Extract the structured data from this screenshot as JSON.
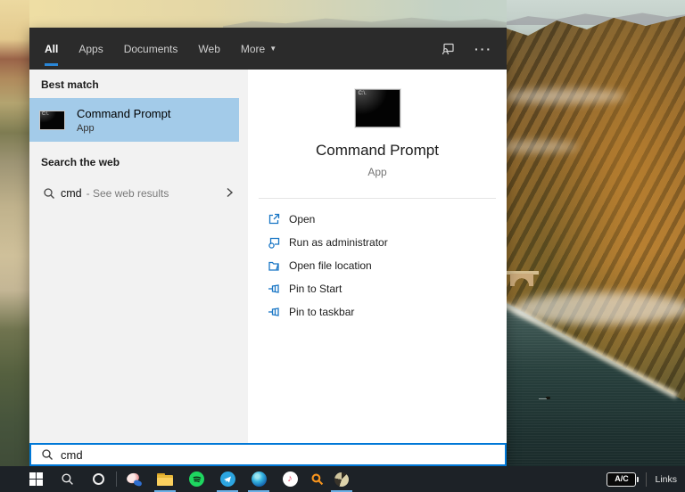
{
  "header": {
    "tabs": [
      {
        "label": "All",
        "active": true
      },
      {
        "label": "Apps",
        "active": false
      },
      {
        "label": "Documents",
        "active": false
      },
      {
        "label": "Web",
        "active": false
      },
      {
        "label": "More",
        "active": false,
        "has_dropdown": true
      }
    ],
    "icons": [
      "feedback-icon",
      "ellipsis-icon"
    ]
  },
  "left_panel": {
    "best_match_label": "Best match",
    "best_match": {
      "title": "Command Prompt",
      "subtitle": "App",
      "icon": "cmd-terminal-icon"
    },
    "search_web_label": "Search the web",
    "web_result": {
      "query": "cmd",
      "hint": "- See web results",
      "icon": "search-icon",
      "chevron": "chevron-right-icon"
    }
  },
  "right_panel": {
    "title": "Command Prompt",
    "subtitle": "App",
    "icon": "cmd-terminal-icon-large",
    "actions": [
      {
        "icon": "open-icon",
        "label": "Open"
      },
      {
        "icon": "run-as-admin-icon",
        "label": "Run as administrator"
      },
      {
        "icon": "file-location-icon",
        "label": "Open file location"
      },
      {
        "icon": "pin-to-start-icon",
        "label": "Pin to Start"
      },
      {
        "icon": "pin-to-taskbar-icon",
        "label": "Pin to taskbar"
      }
    ]
  },
  "search_box": {
    "value": "cmd",
    "icon": "search-icon"
  },
  "taskbar": {
    "buttons": [
      {
        "icon": "start-icon",
        "running": false
      },
      {
        "icon": "search-icon",
        "running": false
      },
      {
        "icon": "cortana-icon",
        "running": false
      },
      {
        "icon": "pinned-app-icon",
        "running": false
      },
      {
        "icon": "file-explorer-icon",
        "running": true
      },
      {
        "icon": "spotify-icon",
        "running": false
      },
      {
        "icon": "telegram-icon",
        "running": true
      },
      {
        "icon": "edge-icon",
        "running": true
      },
      {
        "icon": "music-app-icon",
        "running": false
      },
      {
        "icon": "search-tool-icon",
        "running": false
      },
      {
        "icon": "clock-app-icon",
        "running": true
      }
    ],
    "tray": {
      "battery_label": "A/C",
      "links_label": "Links"
    }
  },
  "colors": {
    "accent_blue": "#0078d7",
    "highlight_blue": "#a3cbe9",
    "tab_underline": "#2986d7",
    "action_icon_blue": "#1976c5",
    "header_bg": "#2b2b2b",
    "left_panel_bg": "#f2f2f2",
    "taskbar_bg": "#1d2227"
  }
}
